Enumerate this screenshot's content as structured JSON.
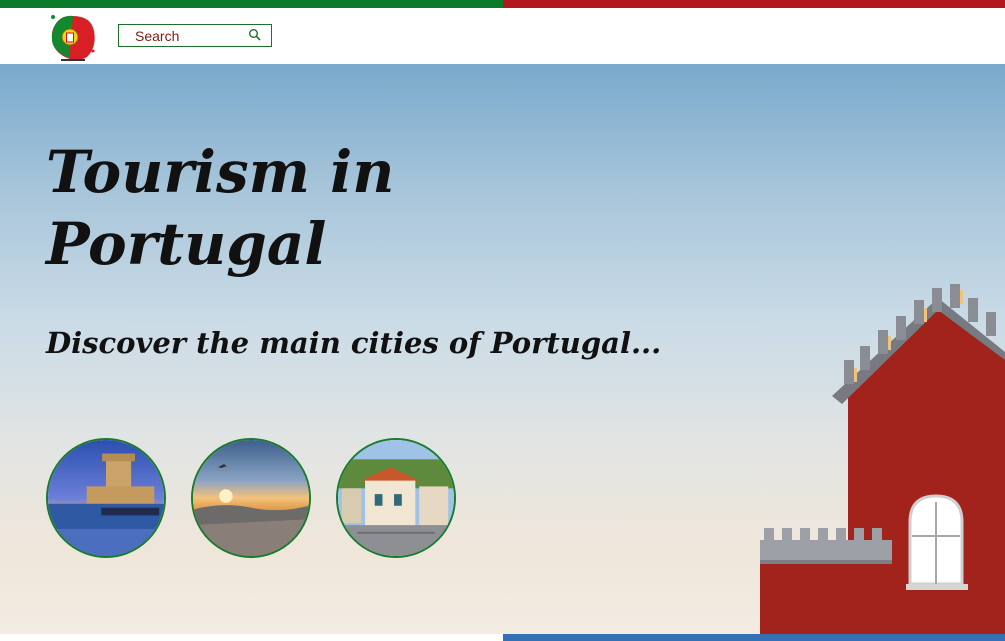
{
  "header": {
    "search": {
      "placeholder": "Search",
      "value": ""
    },
    "logo": {
      "icon": "portugal-map-logo"
    }
  },
  "hero": {
    "title": "Tourism in Portugal",
    "subtitle": "Discover the main cities of Portugal..."
  },
  "colors": {
    "accent_green": "#0b7a2a",
    "accent_red": "#b0161b",
    "accent_blue": "#3470b4",
    "search_text": "#7a1c14"
  }
}
